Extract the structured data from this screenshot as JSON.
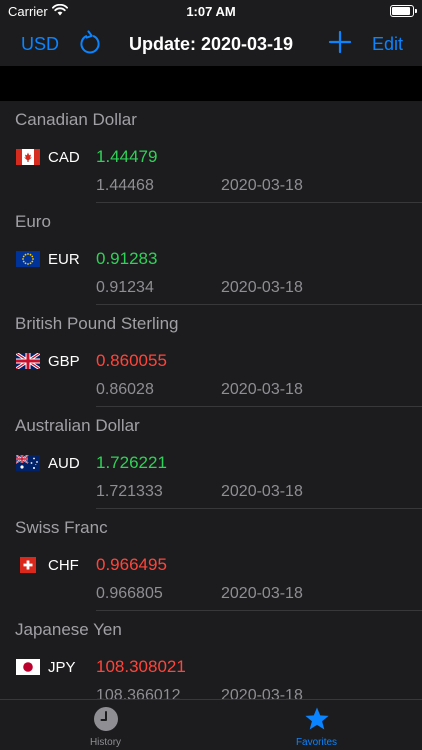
{
  "status_bar": {
    "carrier": "Carrier",
    "time": "1:07 AM"
  },
  "nav": {
    "currency_button": "USD",
    "title": "Update: 2020-03-19",
    "edit_button": "Edit"
  },
  "colors": {
    "accent": "#0a84ff",
    "rate_up": "#30d158",
    "rate_down": "#ff453a"
  },
  "currencies": [
    {
      "name": "Canadian Dollar",
      "code": "CAD",
      "flag": "canada-flag-icon",
      "rate": "1.44479",
      "trend": "up",
      "previous": "1.44468",
      "date": "2020-03-18"
    },
    {
      "name": "Euro",
      "code": "EUR",
      "flag": "eu-flag-icon",
      "rate": "0.91283",
      "trend": "up",
      "previous": "0.91234",
      "date": "2020-03-18"
    },
    {
      "name": "British Pound Sterling",
      "code": "GBP",
      "flag": "uk-flag-icon",
      "rate": "0.860055",
      "trend": "down",
      "previous": "0.86028",
      "date": "2020-03-18"
    },
    {
      "name": "Australian Dollar",
      "code": "AUD",
      "flag": "australia-flag-icon",
      "rate": "1.726221",
      "trend": "up",
      "previous": "1.721333",
      "date": "2020-03-18"
    },
    {
      "name": "Swiss Franc",
      "code": "CHF",
      "flag": "switzerland-flag-icon",
      "rate": "0.966495",
      "trend": "down",
      "previous": "0.966805",
      "date": "2020-03-18"
    },
    {
      "name": "Japanese Yen",
      "code": "JPY",
      "flag": "japan-flag-icon",
      "rate": "108.308021",
      "trend": "down",
      "previous": "108.366012",
      "date": "2020-03-18"
    }
  ],
  "tabs": [
    {
      "label": "History",
      "icon": "clock-icon",
      "selected": false
    },
    {
      "label": "Favorites",
      "icon": "star-icon",
      "selected": true
    }
  ]
}
